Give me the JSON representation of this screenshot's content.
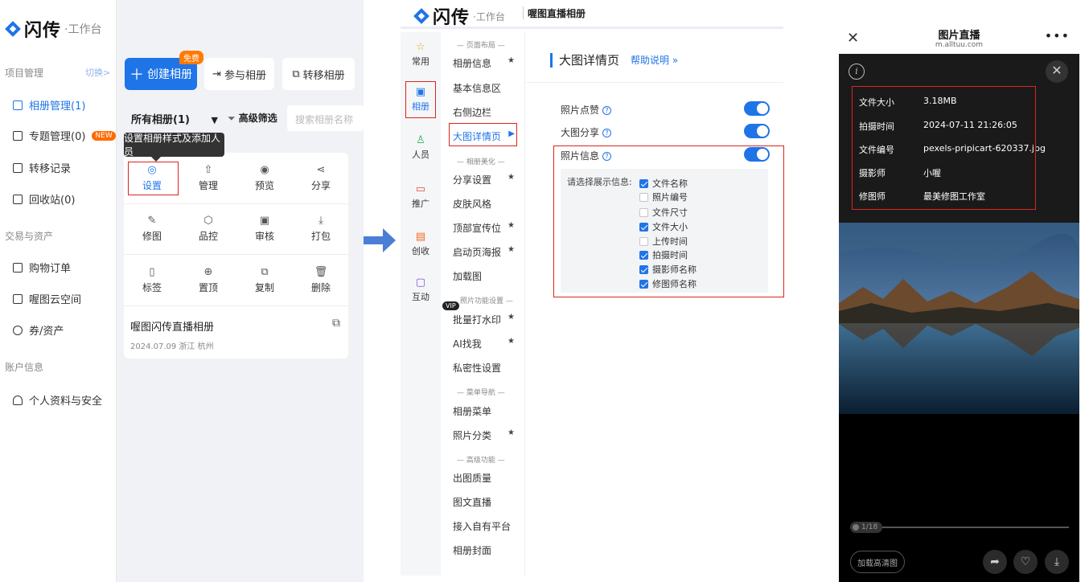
{
  "colors": {
    "accent": "#1f74e8",
    "highlight_border": "#d9261c",
    "badge_orange": "#ff7a00"
  },
  "panel1": {
    "brand": {
      "name": "闪传",
      "sub": "·工作台"
    },
    "sidebar": {
      "group_project": "项目管理",
      "switch_link": "切换>",
      "items_project": [
        {
          "label": "相册管理(1)",
          "icon": "album-icon",
          "active": true
        },
        {
          "label": "专题管理(0)",
          "icon": "layers-icon",
          "badge": "NEW"
        },
        {
          "label": "转移记录",
          "icon": "transfer-icon"
        },
        {
          "label": "回收站(0)",
          "icon": "trash-icon"
        }
      ],
      "group_trade": "交易与资产",
      "items_trade": [
        {
          "label": "购物订单",
          "icon": "order-icon"
        },
        {
          "label": "喔图云空间",
          "icon": "cloud-space-icon"
        },
        {
          "label": "券/资产",
          "icon": "coupon-icon"
        }
      ],
      "group_account": "账户信息",
      "items_account": [
        {
          "label": "个人资料与安全",
          "icon": "user-icon"
        }
      ]
    },
    "toolbar": {
      "create_label": "创建相册",
      "free_badge": "免费",
      "join_label": "参与相册",
      "transfer_label": "转移相册"
    },
    "filter": {
      "all_albums": "所有相册(1)",
      "advanced": "高级筛选",
      "search_placeholder": "搜索相册名称"
    },
    "tooltip": "设置相册样式及添加人员",
    "actions": [
      {
        "label": "设置",
        "icon": "settings-icon"
      },
      {
        "label": "管理",
        "icon": "manage-icon"
      },
      {
        "label": "预览",
        "icon": "preview-icon"
      },
      {
        "label": "分享",
        "icon": "share-icon"
      },
      {
        "label": "修图",
        "icon": "retouch-icon"
      },
      {
        "label": "品控",
        "icon": "quality-icon"
      },
      {
        "label": "审核",
        "icon": "review-icon"
      },
      {
        "label": "打包",
        "icon": "download-icon"
      },
      {
        "label": "标签",
        "icon": "tag-icon"
      },
      {
        "label": "置顶",
        "icon": "pin-top-icon"
      },
      {
        "label": "复制",
        "icon": "copy-icon"
      },
      {
        "label": "删除",
        "icon": "delete-icon"
      }
    ],
    "album": {
      "title": "喔图闪传直播相册",
      "meta": "2024.07.09 浙江 杭州"
    }
  },
  "panel2": {
    "brand": {
      "name": "闪传",
      "sub": "·工作台"
    },
    "title": "喔图直播相册",
    "rail": [
      {
        "label": "常用",
        "icon": "star-icon"
      },
      {
        "label": "相册",
        "icon": "image-icon",
        "active": true
      },
      {
        "label": "人员",
        "icon": "people-icon"
      },
      {
        "label": "推广",
        "icon": "promote-icon"
      },
      {
        "label": "创收",
        "icon": "revenue-icon"
      },
      {
        "label": "互动",
        "icon": "interact-icon"
      }
    ],
    "menu": {
      "sec_layout": "— 页面布局 —",
      "layout_items": [
        "相册信息",
        "基本信息区",
        "右侧边栏",
        "大图详情页"
      ],
      "sec_beauty": "— 相册美化 —",
      "beauty_items": [
        "分享设置",
        "皮肤风格",
        "顶部宣传位",
        "启动页海报",
        "加载图"
      ],
      "sec_photo": "照片功能设置 —",
      "vip": "VIP",
      "photo_items": [
        "批量打水印",
        "AI找我",
        "私密性设置"
      ],
      "sec_nav": "— 菜单导航 —",
      "nav_items": [
        "相册菜单",
        "照片分类"
      ],
      "sec_adv": "— 高级功能 —",
      "adv_items": [
        "出图质量",
        "图文直播",
        "接入自有平台",
        "相册封面"
      ],
      "star": "★"
    },
    "content": {
      "title": "大图详情页",
      "help": "帮助说明 »",
      "options": [
        "照片点赞",
        "大图分享",
        "照片信息"
      ],
      "info_label": "请选择展示信息:",
      "checks": [
        {
          "label": "文件名称",
          "on": true
        },
        {
          "label": "照片编号",
          "on": false
        },
        {
          "label": "文件尺寸",
          "on": false
        },
        {
          "label": "文件大小",
          "on": true
        },
        {
          "label": "上传时间",
          "on": false
        },
        {
          "label": "拍摄时间",
          "on": true
        },
        {
          "label": "摄影师名称",
          "on": true
        },
        {
          "label": "修图师名称",
          "on": true
        }
      ]
    }
  },
  "panel3": {
    "title": "图片直播",
    "url": "m.alltuu.com",
    "meta": [
      {
        "k": "文件大小",
        "v": "3.18MB"
      },
      {
        "k": "拍摄时间",
        "v": "2024-07-11 21:26:05"
      },
      {
        "k": "文件编号",
        "v": "pexels-pripicart-620337.jpg"
      },
      {
        "k": "摄影师",
        "v": "小喔"
      },
      {
        "k": "修图师",
        "v": "最美修图工作室"
      }
    ],
    "progress": "1/18",
    "hd_button": "加载高清图"
  }
}
